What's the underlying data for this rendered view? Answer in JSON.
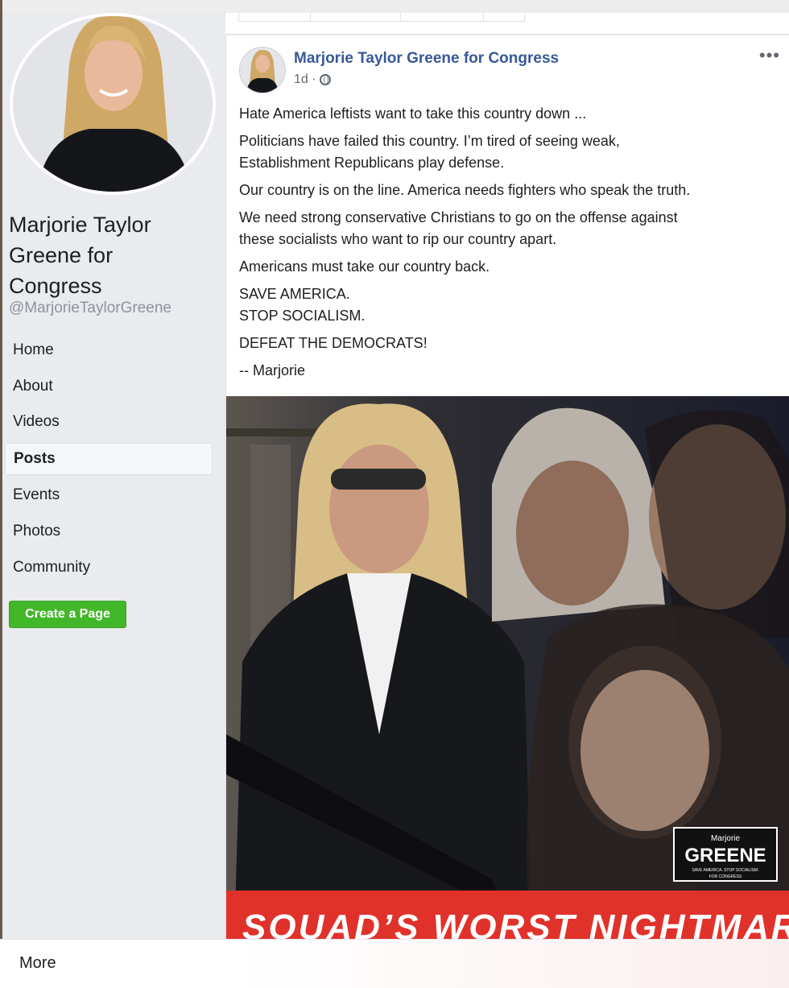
{
  "sidebar": {
    "page_name": "Marjorie Taylor Greene for Congress",
    "handle": "@MarjorieTaylorGreene",
    "nav": [
      "Home",
      "About",
      "Videos",
      "Posts",
      "Events",
      "Photos",
      "Community"
    ],
    "active_nav": "Posts",
    "create_page": "Create a Page"
  },
  "post": {
    "author": "Marjorie Taylor Greene for Congress",
    "time": "1d ·",
    "privacy_icon": "globe-icon",
    "paragraphs": [
      "Hate America leftists want to take this country down ...",
      "Politicians have failed this country. I’m tired of seeing weak,\nEstablishment Republicans play defense.",
      "Our country is on the line. America needs fighters who speak the truth.",
      "We need strong conservative Christians to go on the offense against\nthese socialists who want to rip our country apart.",
      "Americans must take our country back.",
      "SAVE AMERICA.\nSTOP SOCIALISM.",
      "DEFEAT THE DEMOCRATS!",
      "-- Marjorie"
    ],
    "image": {
      "logo_top": "Marjorie",
      "logo_main": "GREENE",
      "logo_sub": "SAVE AMERICA. STOP SOCIALISM.",
      "logo_sub2": "FOR CONGRESS",
      "banner": "SQUAD’S WORST NIGHTMARE"
    }
  },
  "footer": {
    "more": "More"
  },
  "colors": {
    "link": "#385898",
    "green_button": "#42b72a",
    "banner_red": "#e0322b"
  }
}
